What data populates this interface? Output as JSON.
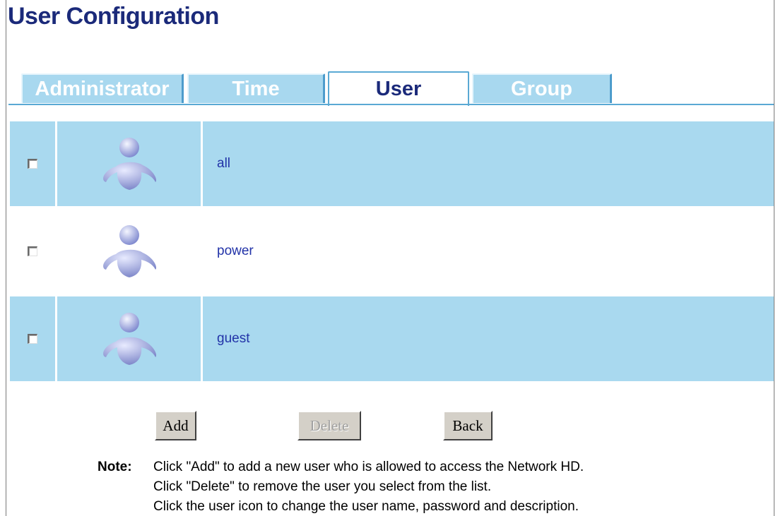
{
  "page": {
    "title": "User Configuration"
  },
  "tabs": [
    {
      "label": "Administrator",
      "active": false
    },
    {
      "label": "Time",
      "active": false
    },
    {
      "label": "User",
      "active": true
    },
    {
      "label": "Group",
      "active": false
    }
  ],
  "users": [
    {
      "name": "all",
      "checked": false,
      "icon": "user-avatar-icon"
    },
    {
      "name": "power",
      "checked": false,
      "icon": "user-avatar-icon"
    },
    {
      "name": "guest",
      "checked": false,
      "icon": "user-avatar-icon"
    }
  ],
  "buttons": {
    "add": "Add",
    "delete": "Delete",
    "back": "Back"
  },
  "note": {
    "label": "Note:",
    "lines": [
      "Click \"Add\" to add a new user who is allowed to access the Network HD.",
      "Click \"Delete\" to remove the user you select from the list.",
      "Click the user icon to change the user name, password and description."
    ]
  },
  "colors": {
    "title": "#1b2a7a",
    "tab_inactive_bg": "#a8d8ef",
    "row_shade": "#a9d9ef",
    "user_link": "#2233a8",
    "button_face": "#d4d0c8"
  }
}
